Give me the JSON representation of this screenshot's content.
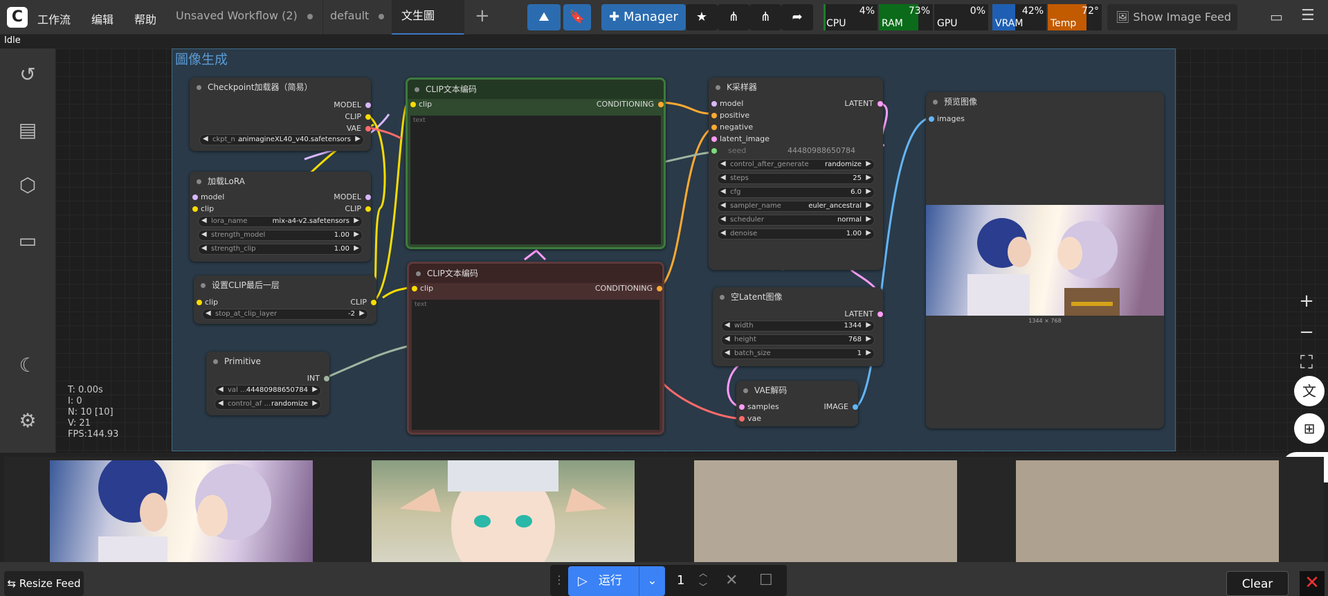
{
  "menu": {
    "workflow": "工作流",
    "edit": "编辑",
    "help": "帮助"
  },
  "tabs": [
    "Unsaved Workflow (2)",
    "default",
    "文生圖"
  ],
  "manager_label": "Manager",
  "monitors": {
    "cpu": {
      "label": "CPU",
      "value": "4%",
      "pct": 0.04
    },
    "ram": {
      "label": "RAM",
      "value": "73%",
      "pct": 0.73
    },
    "gpu": {
      "label": "GPU",
      "value": "0%",
      "pct": 0
    },
    "vram": {
      "label": "VRAM",
      "value": "42%",
      "pct": 0.42
    },
    "temp": {
      "label": "Temp",
      "value": "72°",
      "pct": 0.72
    }
  },
  "show_feed": "Show Image Feed",
  "status": "Idle",
  "stats": [
    "T: 0.00s",
    "I: 0",
    "N: 10 [10]",
    "V: 21",
    "FPS:144.93"
  ],
  "group_title": "圖像生成",
  "nodes": {
    "ckpt": {
      "title": "Checkpoint加载器（简易）",
      "out1": "MODEL",
      "out2": "CLIP",
      "out3": "VAE",
      "w_label": "ckpt_n ...",
      "w_value": "animagineXL40_v40.safetensors"
    },
    "lora": {
      "title": "加载LoRA",
      "in1": "model",
      "in2": "clip",
      "out1": "MODEL",
      "out2": "CLIP",
      "w1_label": "lora_name",
      "w1_value": "mix-a4-v2.safetensors",
      "w2_label": "strength_model",
      "w2_value": "1.00",
      "w3_label": "strength_clip",
      "w3_value": "1.00"
    },
    "clipskip": {
      "title": "设置CLIP最后一层",
      "in1": "clip",
      "out1": "CLIP",
      "w_label": "stop_at_clip_layer",
      "w_value": "-2"
    },
    "primitive": {
      "title": "Primitive",
      "out1": "INT",
      "w1_label": "val ...",
      "w1_value": "444809886507​84",
      "w2_label": "control_af ...",
      "w2_value": "randomize"
    },
    "clip_pos": {
      "title": "CLIP文本编码",
      "in1": "clip",
      "out1": "CONDITIONING",
      "placeholder": "text"
    },
    "clip_neg": {
      "title": "CLIP文本编码",
      "in1": "clip",
      "out1": "CONDITIONING",
      "placeholder": "text"
    },
    "ksampler": {
      "title": "K采样器",
      "in1": "model",
      "in2": "positive",
      "in3": "negative",
      "in4": "latent_image",
      "in5": "seed",
      "seed_value": "444809886507​84",
      "out1": "LATENT",
      "widgets": [
        {
          "label": "control_after_generate",
          "value": "randomize"
        },
        {
          "label": "steps",
          "value": "25"
        },
        {
          "label": "cfg",
          "value": "6.0"
        },
        {
          "label": "sampler_name",
          "value": "euler_ancestral"
        },
        {
          "label": "scheduler",
          "value": "normal"
        },
        {
          "label": "denoise",
          "value": "1.00"
        }
      ]
    },
    "latent": {
      "title": "空Latent图像",
      "out1": "LATENT",
      "w1_label": "width",
      "w1_value": "1344",
      "w2_label": "height",
      "w2_value": "768",
      "w3_label": "batch_size",
      "w3_value": "1"
    },
    "vae": {
      "title": "VAE解码",
      "in1": "samples",
      "in2": "vae",
      "out1": "IMAGE"
    },
    "preview": {
      "title": "预览图像",
      "in1": "images",
      "size": "1344 × 768"
    }
  },
  "bottom": {
    "resize": "Resize Feed",
    "run": "运行",
    "count": "1",
    "clear": "Clear"
  }
}
